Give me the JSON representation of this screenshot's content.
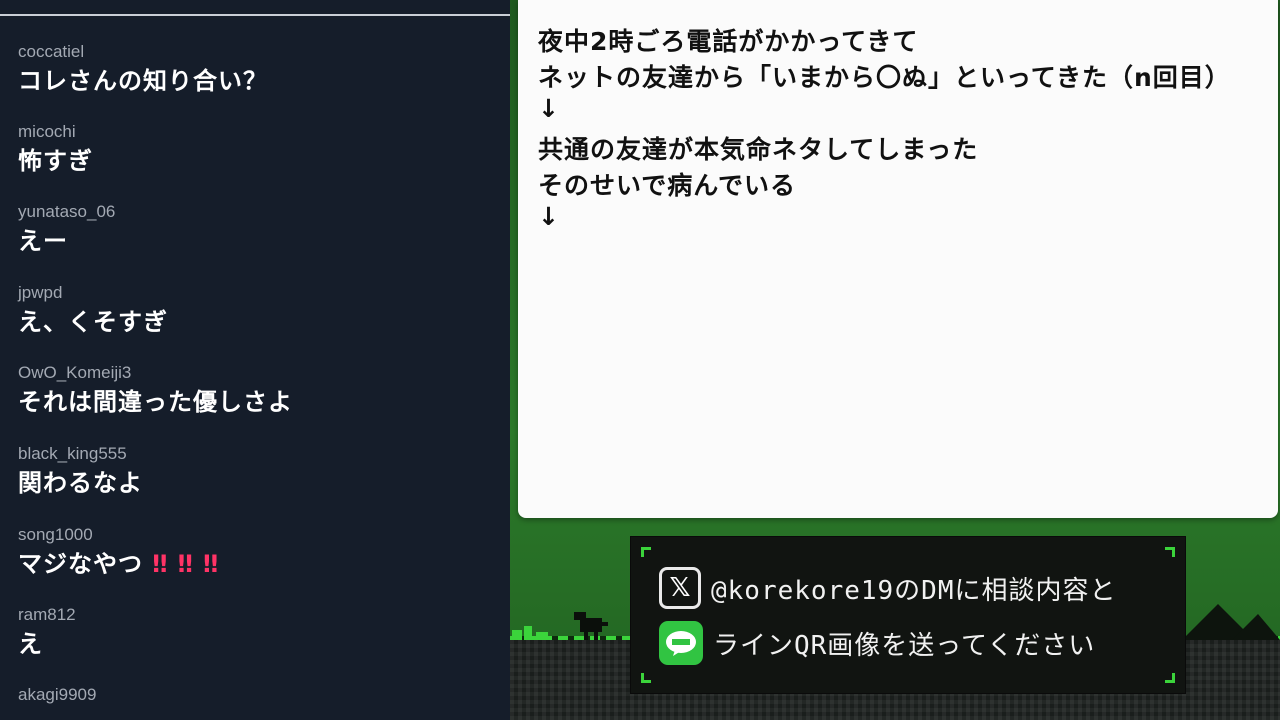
{
  "chat": {
    "messages": [
      {
        "user": "coccatiel",
        "text": "コレさんの知り合い？"
      },
      {
        "user": "micochi",
        "text": "怖すぎ"
      },
      {
        "user": "yunataso_06",
        "text": "えー"
      },
      {
        "user": "jpwpd",
        "text": "え、くそすぎ"
      },
      {
        "user": "OwO_Komeiji3",
        "text": "それは間違った優しさよ"
      },
      {
        "user": "black_king555",
        "text": "関わるなよ"
      },
      {
        "user": "song1000",
        "text": "マジなやつ",
        "emotes": "‼ ‼ ‼"
      },
      {
        "user": "ram812",
        "text": "え"
      },
      {
        "user": "akagi9909",
        "text": ""
      }
    ]
  },
  "note": {
    "lines": [
      "夜中2時ごろ電話がかかってきて",
      "ネットの友達から「いまから〇ぬ」といってきた（n回目）",
      "↓",
      "共通の友達が本気命ネタしてしまった",
      "そのせいで病んでいる",
      "↓"
    ]
  },
  "banner": {
    "x_text": "@korekore19のDMに相談内容と",
    "line_text": "ラインQR画像を送ってください",
    "x_icon": "x-logo-icon",
    "line_icon": "line-app-icon"
  },
  "colors": {
    "chat_bg": "#151d2a",
    "accent_green": "#3bd43b",
    "emote_red": "#ff3366"
  }
}
